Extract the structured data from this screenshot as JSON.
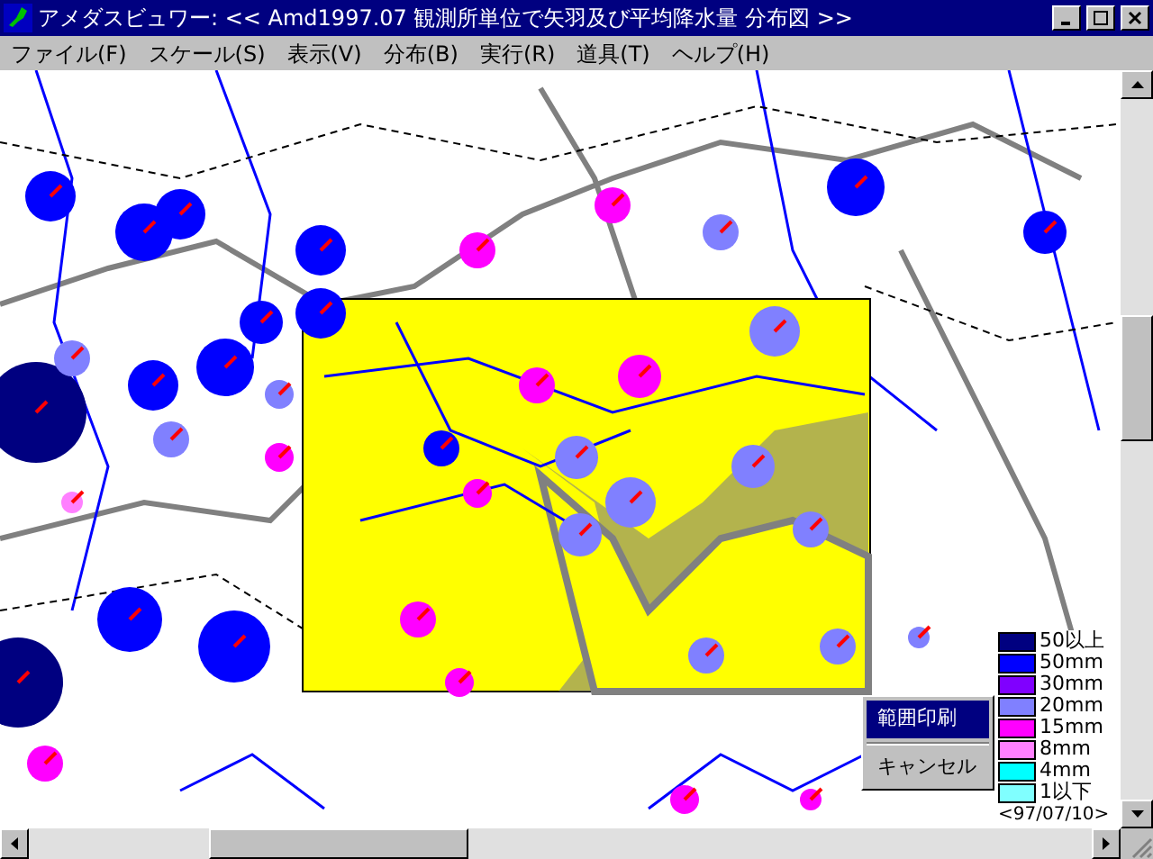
{
  "window": {
    "title": "アメダスビュワー: << Amd1997.07 観測所単位で矢羽及び平均降水量 分布図 >>"
  },
  "menu": [
    "ファイル(F)",
    "スケール(S)",
    "表示(V)",
    "分布(B)",
    "実行(R)",
    "道具(T)",
    "ヘルプ(H)"
  ],
  "legend": {
    "items": [
      {
        "label": "50以上",
        "color": "#000080"
      },
      {
        "label": "50mm",
        "color": "#0000ff"
      },
      {
        "label": "30mm",
        "color": "#8000ff"
      },
      {
        "label": "20mm",
        "color": "#8080ff"
      },
      {
        "label": "15mm",
        "color": "#ff00ff"
      },
      {
        "label": "8mm",
        "color": "#ff80ff"
      },
      {
        "label": "4mm",
        "color": "#00ffff"
      },
      {
        "label": "1以下",
        "color": "#80ffff"
      }
    ],
    "date": "<97/07/10>"
  },
  "context_menu": {
    "items": [
      {
        "label": "範囲印刷",
        "selected": true
      },
      {
        "label": "キャンセル",
        "selected": false
      }
    ]
  }
}
